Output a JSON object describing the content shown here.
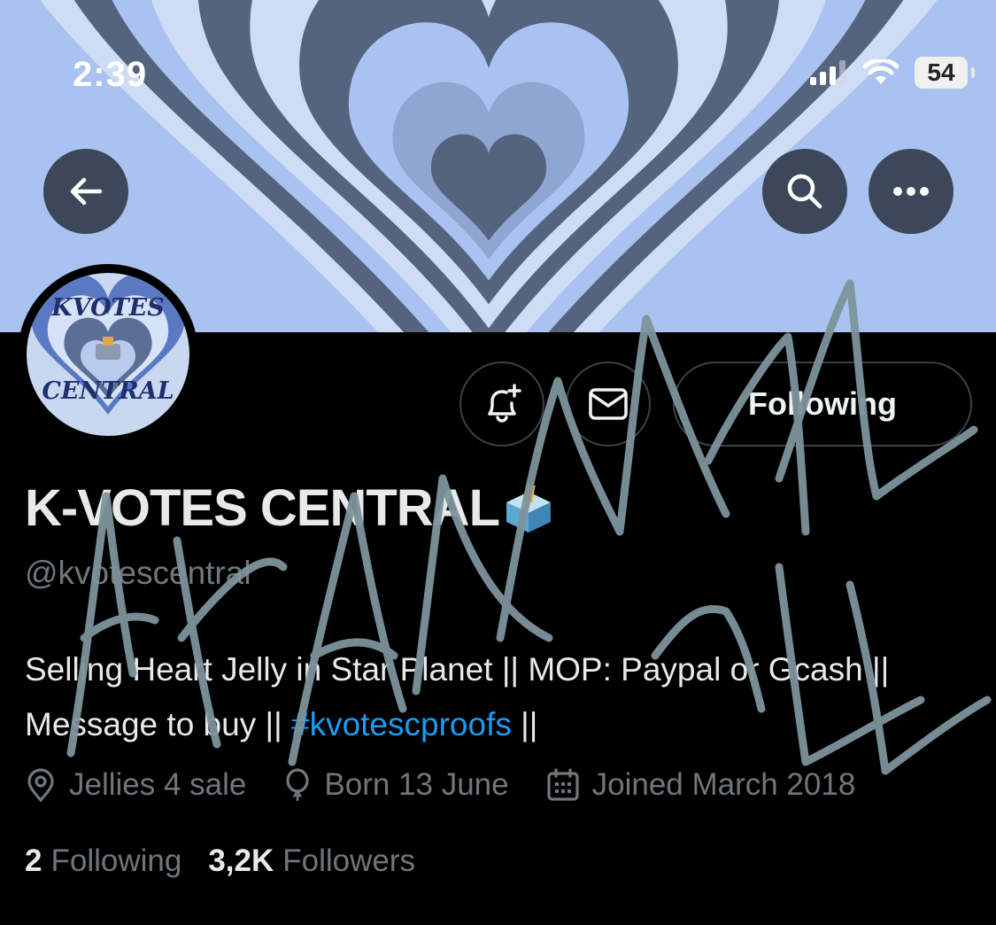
{
  "status_bar": {
    "time": "2:39",
    "battery": "54"
  },
  "header": {
    "back_icon": "arrow-left-icon",
    "search_icon": "search-icon",
    "more_icon": "more-horizontal-icon"
  },
  "avatar": {
    "line1": "KVOTES",
    "line2": "CENTRAL"
  },
  "actions": {
    "notify_icon": "bell-plus-icon",
    "message_icon": "envelope-icon",
    "following_label": "Following"
  },
  "profile": {
    "name": "K-VOTES CENTRAL",
    "name_emoji": "ballot-box-icon",
    "handle": "@kvotescentral",
    "bio_text": "Selling Heart Jelly in Star Planet || MOP: Paypal or Gcash || Message to buy || ",
    "bio_hashtag": "#kvotescproofs",
    "bio_end": " ||",
    "location": "Jellies 4 sale",
    "birthday": "Born 13 June",
    "joined": "Joined March 2018"
  },
  "stats": {
    "following_count": "2",
    "following_label": "Following",
    "followers_count": "3,2K",
    "followers_label": "Followers"
  },
  "colors": {
    "background": "#000000",
    "link": "#1d9bf0",
    "muted": "#71767b",
    "heart_dark": "#55637e",
    "heart_light": "#a9c2f0",
    "heart_pale": "#cfdcf5",
    "scribble": "#7d939b"
  }
}
